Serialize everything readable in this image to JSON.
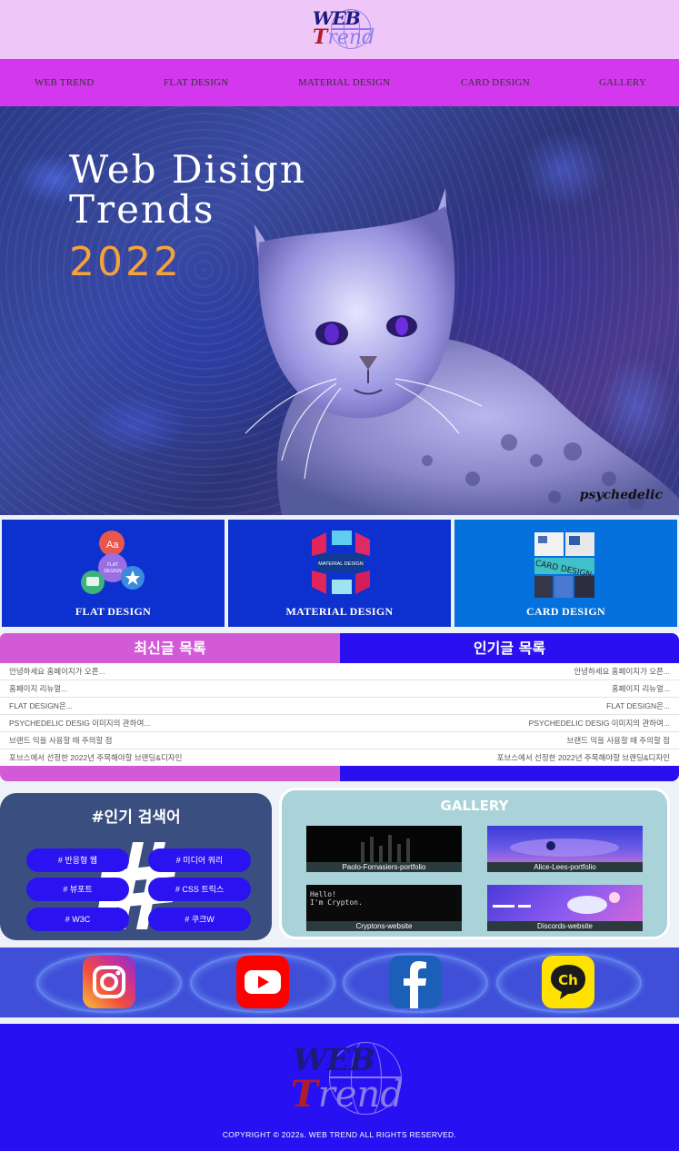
{
  "header": {
    "logo": {
      "web": "WEB",
      "trend": "Trend"
    }
  },
  "nav": {
    "items": [
      {
        "label": "WEB TREND"
      },
      {
        "label": "FLAT DESIGN"
      },
      {
        "label": "MATERIAL DESIGN"
      },
      {
        "label": "CARD DESIGN"
      },
      {
        "label": "GALLERY"
      }
    ]
  },
  "hero": {
    "title_line1": "Web Disign",
    "title_line2": "Trends",
    "year": "2022",
    "tag": "psychedelic"
  },
  "cards": [
    {
      "label": "FLAT DESIGN",
      "bg": "#0c31cf",
      "icon_text": "FLAT DESIGN"
    },
    {
      "label": "MATERIAL DESIGN",
      "bg": "#0c31cf",
      "icon_text": "MATERIAL DESIGN"
    },
    {
      "label": "CARD DESIGN",
      "bg": "#0571dc",
      "icon_text": "CARD DESIGN"
    }
  ],
  "latest": {
    "title": "최신글 목록",
    "rows": [
      "안녕하세요 홈페이지가 오픈...",
      "홈페이지 리뉴얼...",
      "FLAT DESIGN은...",
      "PSYCHEDELIC DESIG 이미지의 관하여...",
      "브랜드 믹을 사용할 때 주의할 점",
      "포브스에서 선정한 2022년 주목해야할 브랜딩&디자인"
    ]
  },
  "popular": {
    "title": "인기글 목록",
    "rows": [
      "안녕하세요 홈페이지가 오픈...",
      "홈페이지 리뉴얼...",
      "FLAT DESIGN은...",
      "PSYCHEDELIC DESIG 이미지의 관하여...",
      "브랜드 믹을 사용할 때 주의할 점",
      "포브스에서 선정한 2022년 주목해야할 브랜딩&디자인"
    ]
  },
  "search": {
    "title": "#인기 검색어",
    "tags": [
      "# 반응형 웹",
      "# 미디어 쿼리",
      "# 뷰포트",
      "# CSS 트릭스",
      "# W3C",
      "# 쿠크W"
    ]
  },
  "gallery": {
    "title": "GALLERY",
    "items": [
      {
        "caption": "Paolo-Fornasiers-portfolio"
      },
      {
        "caption": "Alice-Lees-portfolio"
      },
      {
        "caption": "Cryptons-website",
        "screen_text": "Hello!\nI'm Crypton."
      },
      {
        "caption": "Discords-website"
      }
    ]
  },
  "social": {
    "icons": [
      "instagram-icon",
      "youtube-icon",
      "facebook-icon",
      "kakaotalk-icon"
    ],
    "kakao_text": "Ch"
  },
  "footer": {
    "logo": {
      "web": "WEB",
      "trend": "Trend"
    },
    "copyright": "COPYRIGHT © 2022s. WEB TREND ALL RIGHTS RESERVED."
  },
  "colors": {
    "header_bg": "#eec6f8",
    "nav_bg": "#d338ee",
    "latest_head": "#d35ad6",
    "popular_head": "#2a10f0",
    "footer_bg": "#2710f2",
    "accent_orange": "#f5a23b"
  }
}
